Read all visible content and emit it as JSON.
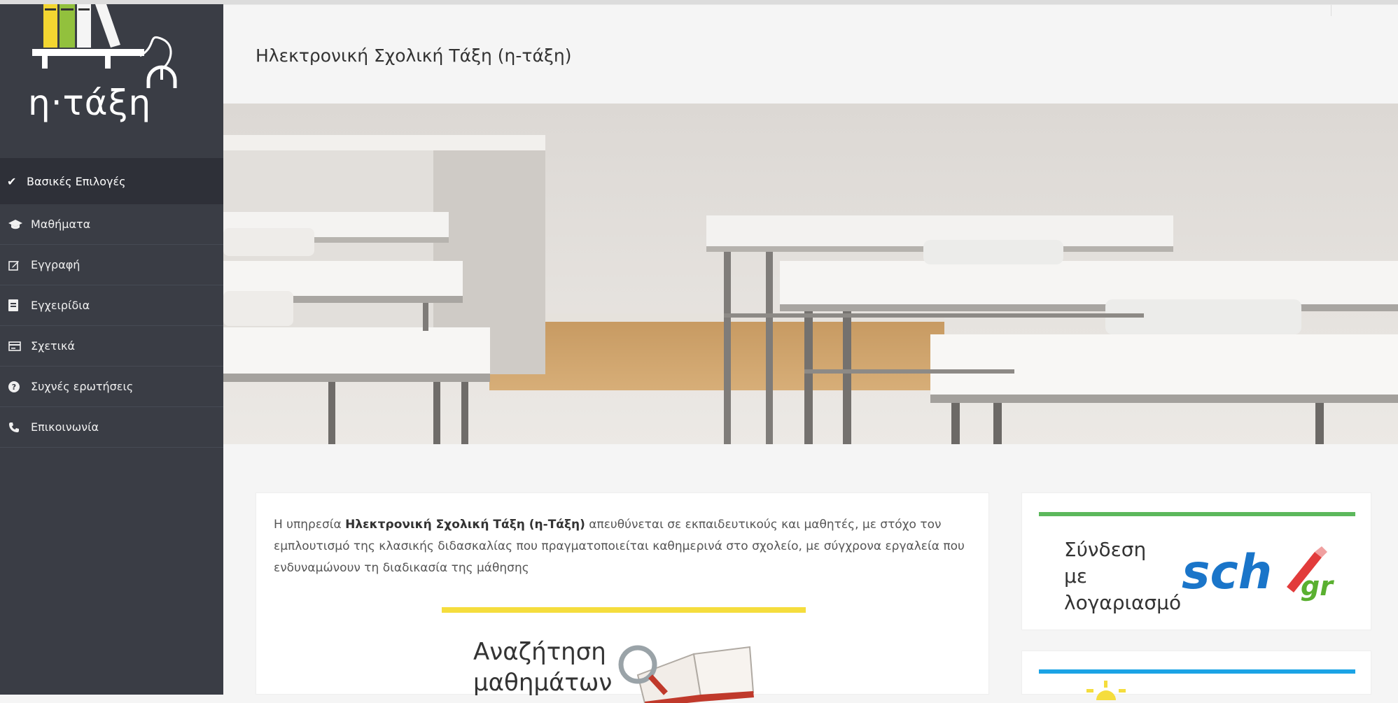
{
  "app": {
    "logo_text": "η·τάξη",
    "page_title": "Ηλεκτρονική Σχολική Τάξη (η-τάξη)"
  },
  "sidebar": {
    "section_title": "Βασικές Επιλογές",
    "items": [
      {
        "label": "Μαθήματα",
        "icon": "graduation-cap-icon"
      },
      {
        "label": "Εγγραφή",
        "icon": "edit-icon"
      },
      {
        "label": "Εγχειρίδια",
        "icon": "document-icon"
      },
      {
        "label": "Σχετικά",
        "icon": "card-icon"
      },
      {
        "label": "Συχνές ερωτήσεις",
        "icon": "question-icon"
      },
      {
        "label": "Επικοινωνία",
        "icon": "phone-icon"
      }
    ]
  },
  "intro": {
    "prefix": "Η υπηρεσία ",
    "bold": "Ηλεκτρονική Σχολική Τάξη (η-Τάξη)",
    "suffix": " απευθύνεται σε εκπαιδευτικούς και μαθητές, με στόχο τον εμπλουτισμό της κλασικής διδασκαλίας που πραγματοποιείται καθημερινά στο σχολείο, με σύγχρονα εργαλεία που ενδυναμώνουν τη διαδικασία της μάθησης"
  },
  "search_card": {
    "title": "Αναζήτηση μαθημάτων"
  },
  "login_card": {
    "text": "Σύνδεση με λογαριασμό",
    "logo_text": "sch",
    "logo_suffix": "gr"
  },
  "colors": {
    "sidebar_bg": "#3a3d45",
    "yellow_accent": "#f5dd3d",
    "green_accent": "#5cb85c",
    "blue_accent": "#1ba3e5",
    "sch_blue": "#1a75c9"
  }
}
